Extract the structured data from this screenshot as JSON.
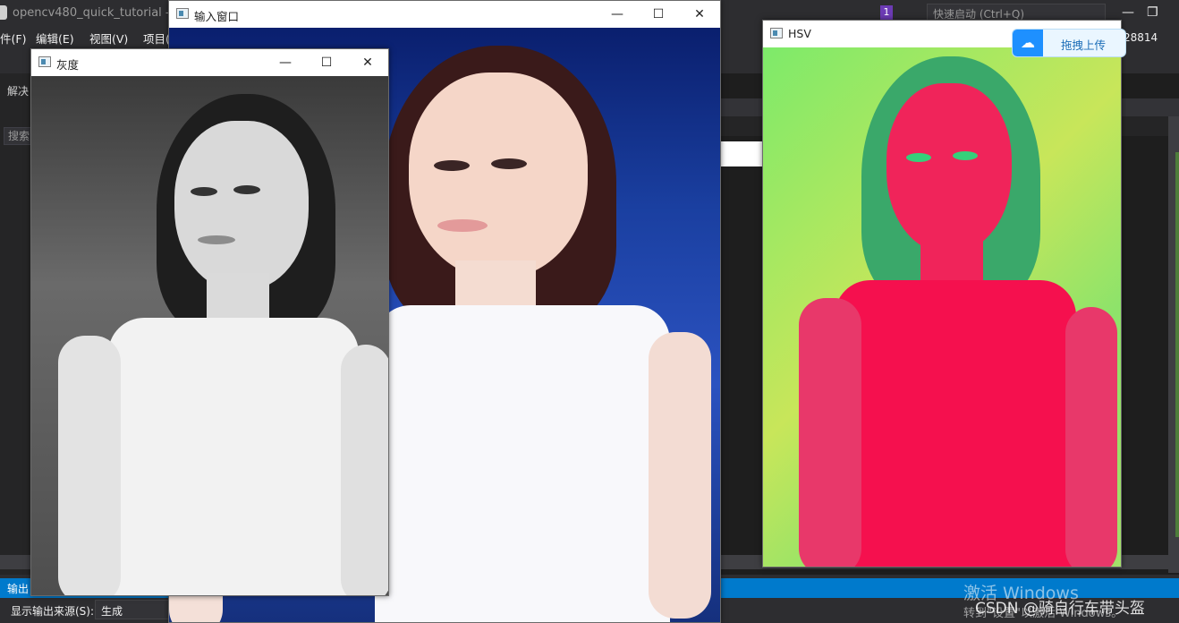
{
  "vs": {
    "title": "opencv480_quick_tutorial - M",
    "quick_launch": "快速启动 (Ctrl+Q)",
    "notification_count": "1",
    "user_suffix": "28814",
    "menu": [
      "件(F)",
      "编辑(E)",
      "视图(V)",
      "项目("
    ],
    "side_labels": {
      "solution": "解决",
      "search": "搜索"
    },
    "output": {
      "panel_title": "输出",
      "source_label": "显示输出来源(S):",
      "source_value": "生成"
    }
  },
  "windows": {
    "gray": {
      "title": "灰度"
    },
    "input": {
      "title": "输入窗口"
    },
    "hsv": {
      "title": "HSV"
    }
  },
  "upload_widget": {
    "label": "拖拽上传"
  },
  "activation": {
    "line1": "激活 Windows",
    "line2": "转到\"设置\"以激活 Windows。"
  },
  "csdn_watermark": "CSDN @骑自行车带头盔",
  "icons": {
    "window_minimize": "—",
    "window_maximize": "☐",
    "window_close": "✕"
  }
}
